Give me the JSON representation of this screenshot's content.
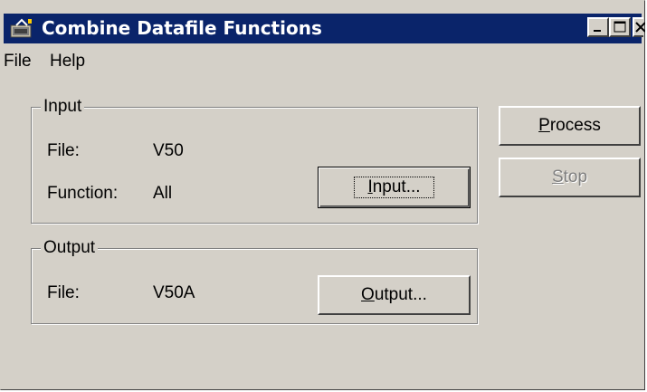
{
  "window": {
    "title": "Combine Datafile Functions"
  },
  "menu": {
    "file": "File",
    "help": "Help"
  },
  "input_group": {
    "legend": "Input",
    "file_label": "File:",
    "file_value": "V50",
    "function_label": "Function:",
    "function_value": "All",
    "button_accel": "I",
    "button_rest": "nput..."
  },
  "output_group": {
    "legend": "Output",
    "file_label": "File:",
    "file_value": "V50A",
    "button_accel": "O",
    "button_rest": "utput..."
  },
  "process_button": {
    "accel": "P",
    "rest": "rocess"
  },
  "stop_button": {
    "accel": "S",
    "rest": "top"
  }
}
